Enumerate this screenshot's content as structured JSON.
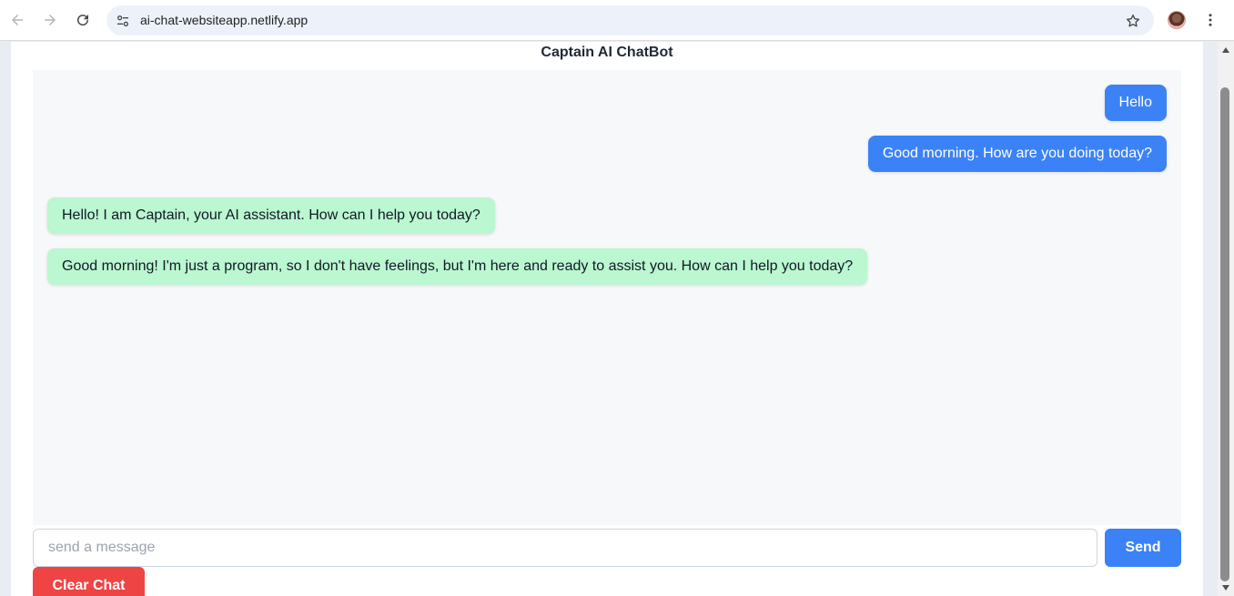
{
  "browser": {
    "url": "ai-chat-websiteapp.netlify.app"
  },
  "page": {
    "title": "Captain AI ChatBot"
  },
  "messages": [
    {
      "role": "user",
      "text": "Hello"
    },
    {
      "role": "user",
      "text": "Good morning. How are you doing today?"
    },
    {
      "role": "assistant",
      "text": "Hello! I am Captain, your AI assistant. How can I help you today?"
    },
    {
      "role": "assistant",
      "text": "Good morning! I'm just a program, so I don't have feelings, but I'm here and ready to assist you. How can I help you today?"
    }
  ],
  "composer": {
    "placeholder": "send a message",
    "value": "",
    "send_label": "Send",
    "clear_label": "Clear Chat"
  },
  "colors": {
    "user_bubble": "#3b82f6",
    "bot_bubble": "#bbf7d0",
    "send_button": "#3b82f6",
    "clear_button": "#ef4444"
  },
  "icons": [
    "back-icon",
    "forward-icon",
    "reload-icon",
    "site-info-icon",
    "star-icon",
    "profile-avatar",
    "more-vert-icon"
  ]
}
